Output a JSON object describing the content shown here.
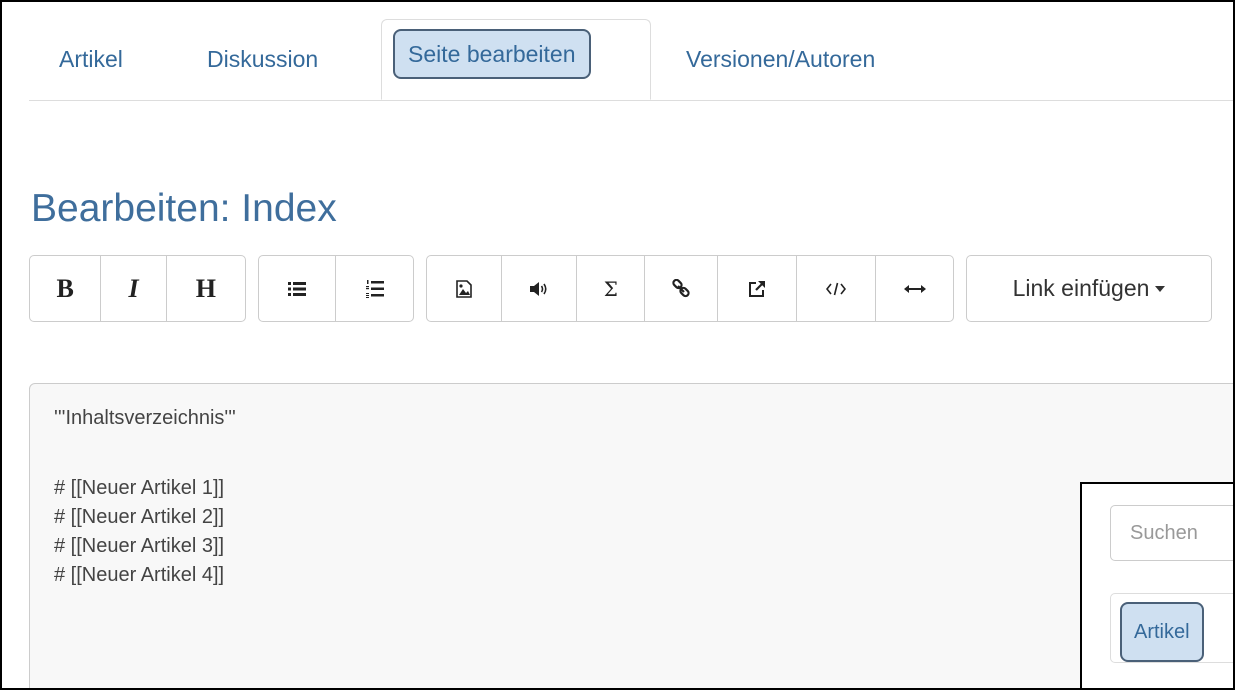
{
  "tabs": [
    {
      "label": "Artikel"
    },
    {
      "label": "Diskussion"
    },
    {
      "label": "Seite bearbeiten"
    },
    {
      "label": "Versionen/Autoren"
    }
  ],
  "active_tab": "Seite bearbeiten",
  "page_title": "Bearbeiten: Index",
  "toolbar": {
    "bold_label": "B",
    "italic_label": "I",
    "heading_label": "H",
    "sum_label": "Σ",
    "link_insert_label": "Link einfügen"
  },
  "editor": {
    "lines": [
      "'''Inhaltsverzeichnis'''",
      "",
      "# [[Neuer Artikel 1]]",
      "# [[Neuer Artikel 2]]",
      "# [[Neuer Artikel 3]]",
      "# [[Neuer Artikel 4]]"
    ]
  },
  "overlay": {
    "search_placeholder": "Suchen",
    "tab_label": "Artikel"
  },
  "colors": {
    "link": "#34699a",
    "title": "#3f6e9c",
    "highlight_bg": "#cfe0f1",
    "highlight_border": "#4a6078"
  }
}
